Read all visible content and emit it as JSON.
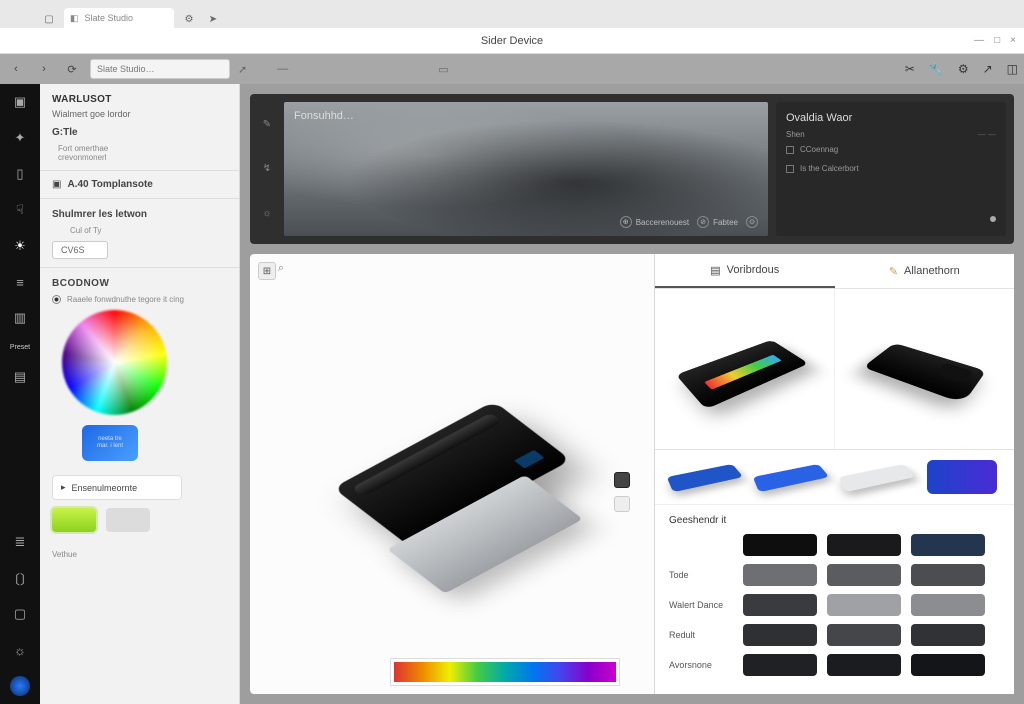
{
  "window": {
    "title": "Sider Device",
    "tab_label": "Slate Studio",
    "close": "×",
    "min": "—",
    "max": "□"
  },
  "urlbar": {
    "placeholder": "Slate Studio…"
  },
  "rail": {
    "items": [
      "home",
      "spark",
      "device",
      "gesture",
      "light",
      "layers",
      "notebook",
      "grid",
      "text-align",
      "brackets",
      "box",
      "color"
    ],
    "label": "Preset"
  },
  "side": {
    "header": "WARLUSOT",
    "sub": "Wialmert goe lordor",
    "group_label": "G:Tle",
    "group_sub1": "Fort omerthae",
    "group_sub2": "crevonmonerl",
    "template_label": "A.40 Tomplansote",
    "section1": "Shulmrer les letwon",
    "field1_label": "Cul of Ty",
    "field1_value": "CV6S",
    "section2": "BCODNOW",
    "radio_label": "Raaele fonwdnuthe tegore it cing",
    "chip_line1": "neeta tre",
    "chip_line2": "mar. i lent",
    "thumb_label": "Ensenulmeornte",
    "swatch_a": "#b6f23a",
    "swatch_b": "#dcdcdc",
    "caption": "Vethue"
  },
  "hero": {
    "main_title": "Fonsuhhd…",
    "tag1": "Baccerenouest",
    "tag2": "Fabtee",
    "card_title": "Ovaldia Waor",
    "card_line1": "Shen",
    "card_line2": "CCoennag",
    "card_line3": "Is the Calcerbort"
  },
  "canvas": {
    "search_icon": "⌕"
  },
  "inspector": {
    "tab1": "Voribrdous",
    "tab2": "Allanethorn",
    "chip_colors": {
      "a": "#1f55c7",
      "b": "#2a62e6",
      "c": "#e7e8ea",
      "d": "linear-gradient(90deg,#1c44c9,#4a2bd6)"
    },
    "swatch_header": "Geeshendr it",
    "rows": [
      {
        "label": "",
        "c": [
          "#0e0e0f",
          "#1a1a1c",
          "#24364f"
        ]
      },
      {
        "label": "Tode",
        "c": [
          "#6e6f73",
          "#5a5c60",
          "#4b4d51"
        ]
      },
      {
        "label": "Walert Dance",
        "c": [
          "#3a3b3e",
          "#9fa1a5",
          "#8b8d91"
        ]
      },
      {
        "label": "Redult",
        "c": [
          "#2f3033",
          "#444649",
          "#303236"
        ]
      },
      {
        "label": "Avorsnone",
        "c": [
          "#202124",
          "#1b1c1f",
          "#141518"
        ]
      }
    ]
  }
}
